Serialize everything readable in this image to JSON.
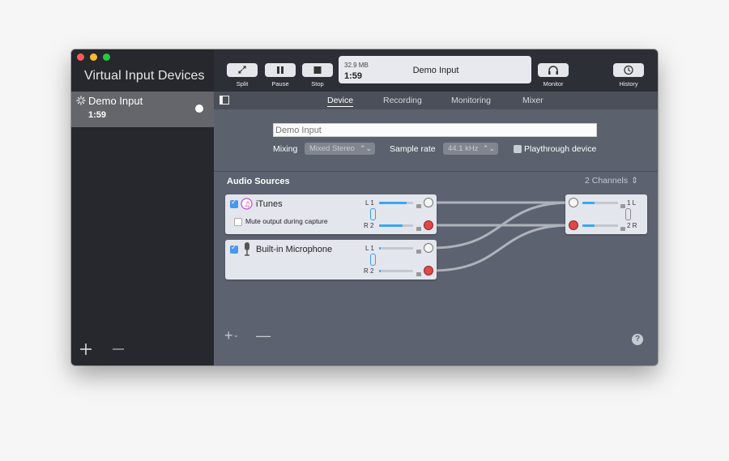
{
  "sidebar": {
    "title": "Virtual Input Devices",
    "selected_device": {
      "name": "Demo Input",
      "time": "1:59"
    }
  },
  "toolbar": {
    "split_label": "Split",
    "pause_label": "Pause",
    "stop_label": "Stop",
    "lcd": {
      "size": "32.9 MB",
      "time": "1:59",
      "name": "Demo Input"
    },
    "monitor_label": "Monitor",
    "history_label": "History"
  },
  "tabs": [
    {
      "label": "Device",
      "active": true
    },
    {
      "label": "Recording",
      "active": false
    },
    {
      "label": "Monitoring",
      "active": false
    },
    {
      "label": "Mixer",
      "active": false
    }
  ],
  "device": {
    "name_placeholder": "Demo Input",
    "mixing_label": "Mixing",
    "mixing_value": "Mixed Stereo",
    "sample_rate_label": "Sample rate",
    "sample_rate_value": "44.1 kHz",
    "playthrough_label": "Playthrough device"
  },
  "sources": {
    "title": "Audio Sources",
    "channels": "2 Channels",
    "items": [
      {
        "name": "iTunes",
        "checked": true,
        "mute_label": "Mute output during capture",
        "ch1": "L 1",
        "ch2": "R 2",
        "level1": 0.8,
        "level2": 0.7
      },
      {
        "name": "Built-in Microphone",
        "checked": true,
        "ch1": "L 1",
        "ch2": "R 2",
        "level1": 0.05,
        "level2": 0.05
      }
    ],
    "output": {
      "ch1": "1 L",
      "ch2": "2 R",
      "level1": 0.35,
      "level2": 0.35
    }
  },
  "colors": {
    "accent": "#3aa6f2",
    "record_port": "#e04848",
    "sidebar": "#26282d"
  }
}
